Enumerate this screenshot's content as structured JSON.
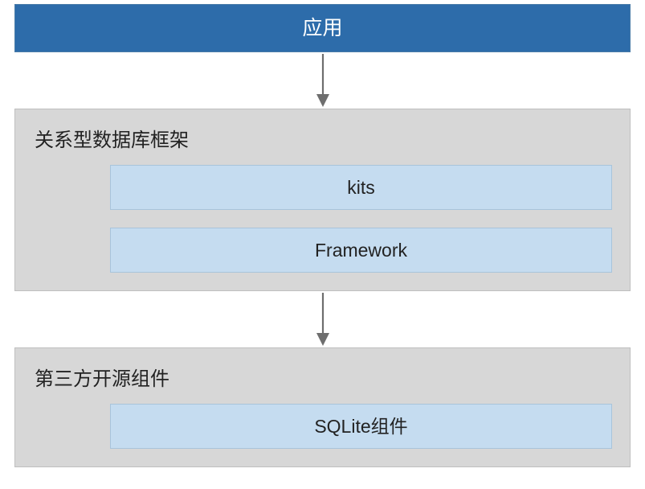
{
  "diagram": {
    "top": {
      "label": "应用"
    },
    "middle": {
      "title": "关系型数据库框架",
      "items": [
        {
          "label": "kits"
        },
        {
          "label": "Framework"
        }
      ]
    },
    "bottom": {
      "title": "第三方开源组件",
      "items": [
        {
          "label": "SQLite组件"
        }
      ]
    }
  }
}
